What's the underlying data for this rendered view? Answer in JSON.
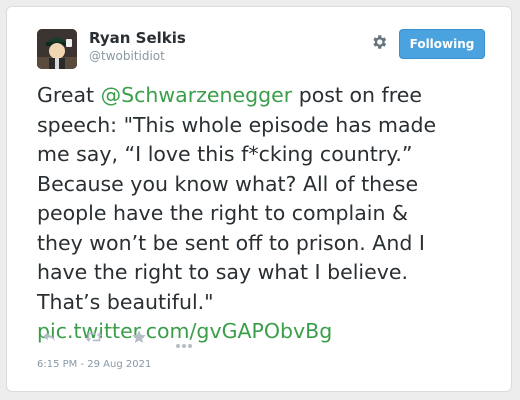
{
  "tweet_card": {
    "author": {
      "name": "Ryan Selkis",
      "handle": "@twobitidiot",
      "avatar_icon": "avatar-cartoon-icon"
    },
    "follow_button_label": "Following",
    "settings_icon": "gear-icon",
    "text": {
      "l1_pre": "Great ",
      "mention": "@Schwarzenegger",
      "l1_post": " post on free",
      "l2": "speech: \"This whole episode has made",
      "l3": "me say, “I love this f*cking country.”",
      "l4": "Because you know what? All of these",
      "l5": "people have the right to complain &",
      "l6": "they won’t be sent off to prison. And I",
      "l7": "have the right to say what I believe.",
      "l8": "That’s beautiful.\"",
      "pic_link": "pic.twitter.com/gvGAPObvBg"
    },
    "actions": {
      "reply_icon": "reply-icon",
      "retweet_icon": "retweet-icon",
      "favorite_icon": "star-icon",
      "more_icon": "more-icon"
    },
    "timestamp": "6:15 PM - 29 Aug 2021"
  },
  "colors": {
    "link": "#3a9e4a",
    "button": "#4aa3df",
    "text": "#292f33",
    "muted": "#8899a6"
  }
}
